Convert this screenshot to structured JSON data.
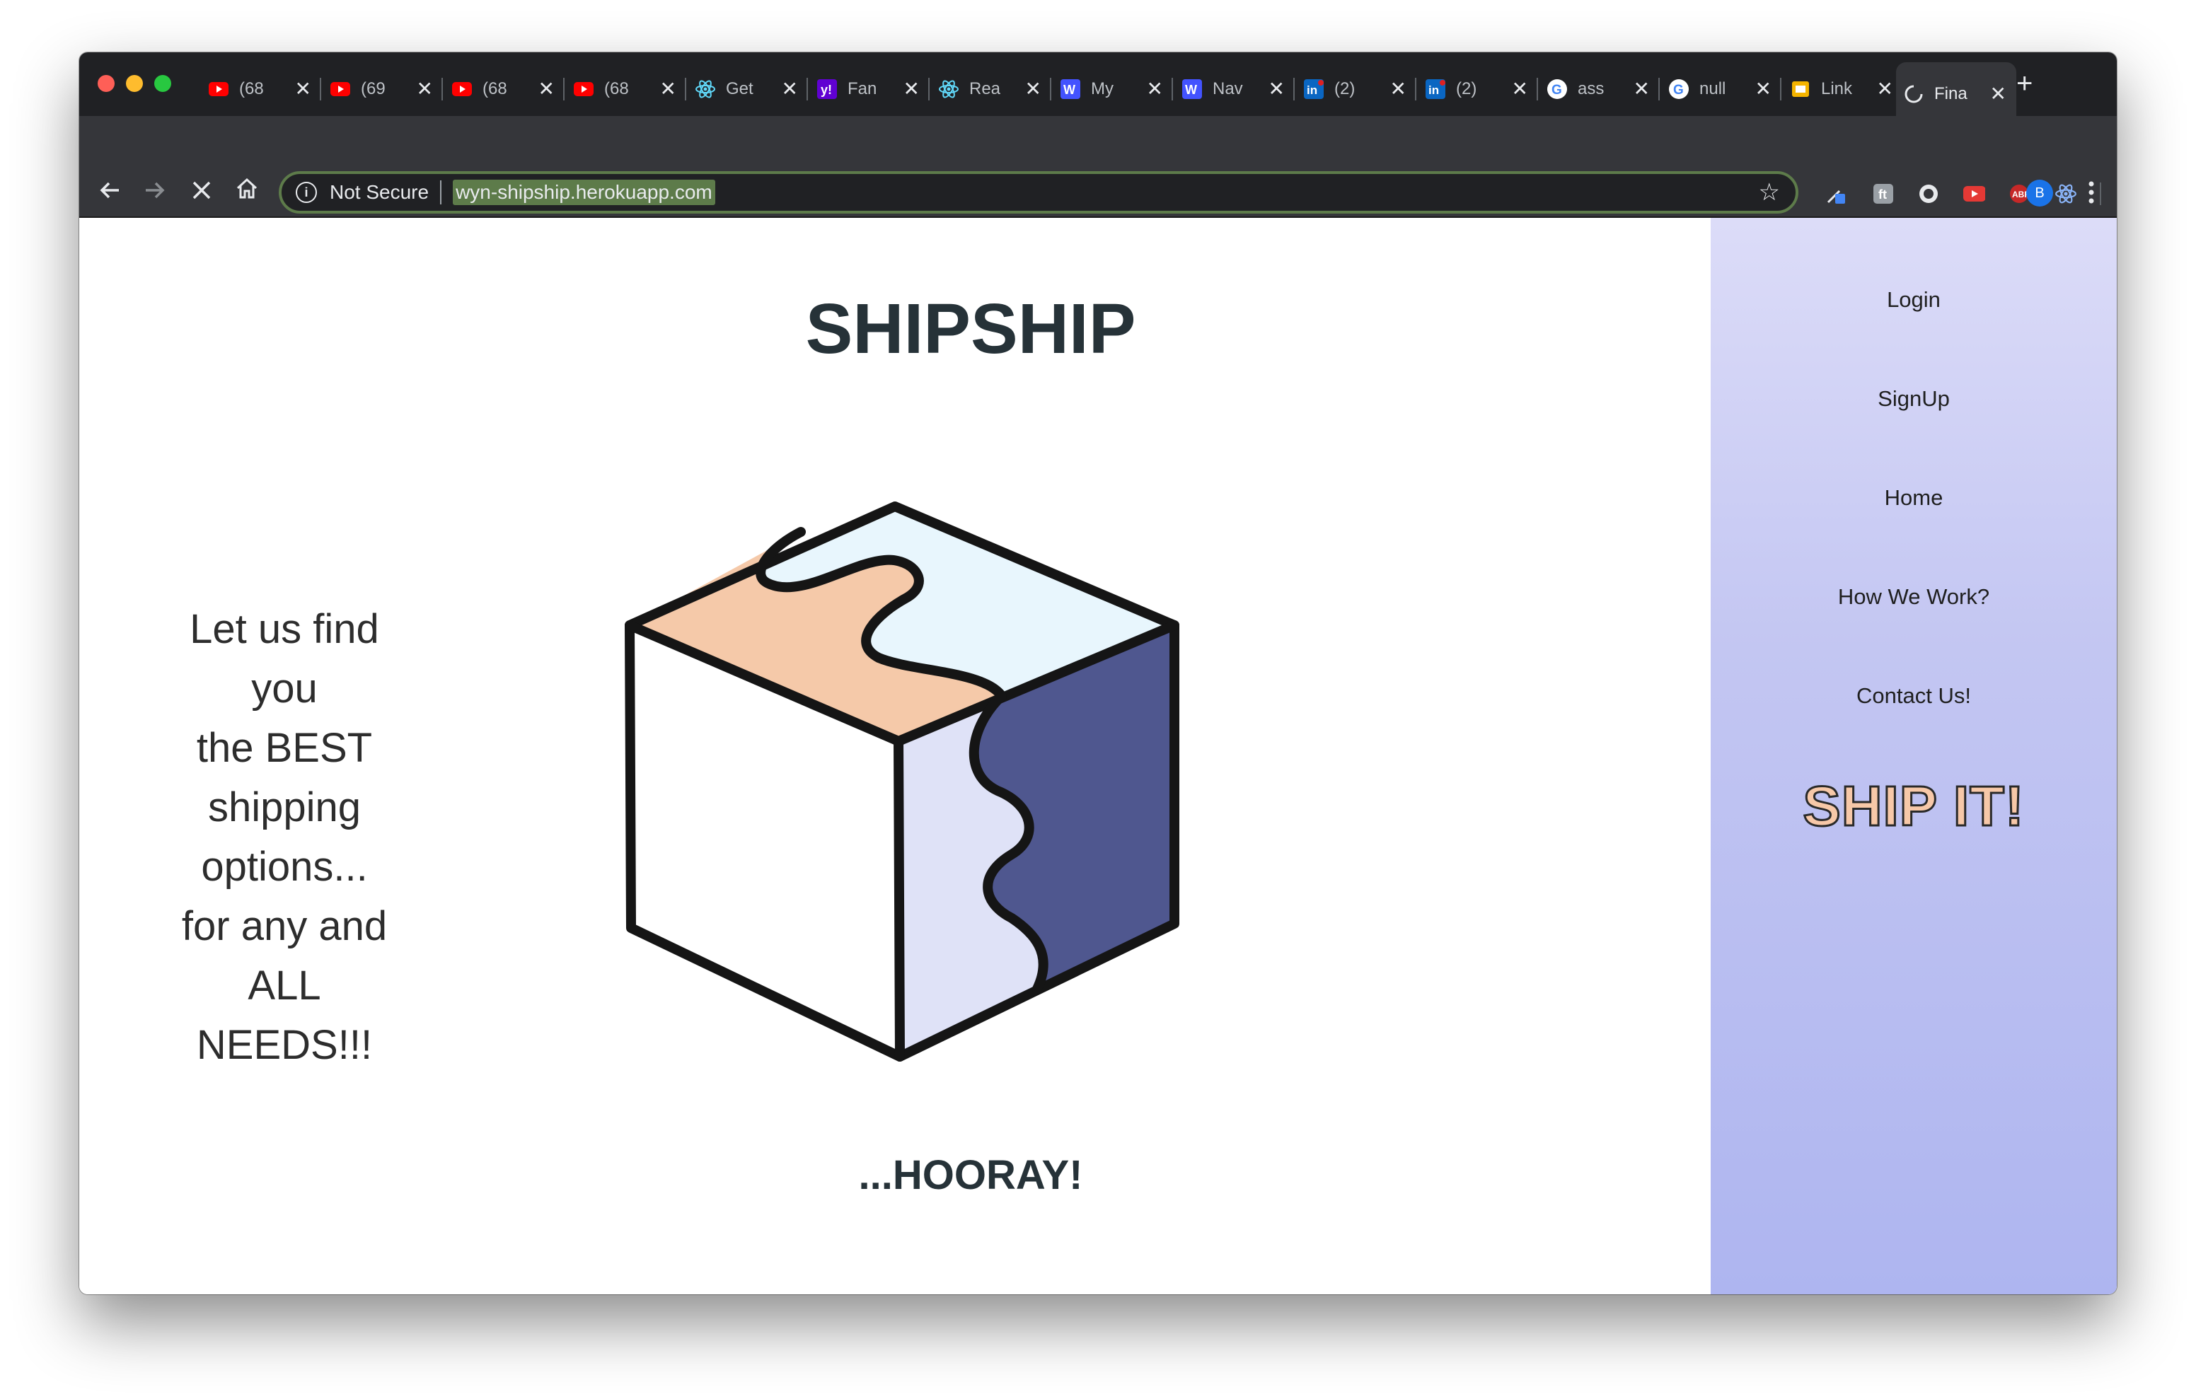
{
  "browser": {
    "tabs": [
      {
        "title": "(68",
        "icon": "youtube-icon"
      },
      {
        "title": "(69",
        "icon": "youtube-icon"
      },
      {
        "title": "(68",
        "icon": "youtube-icon"
      },
      {
        "title": "(68",
        "icon": "youtube-icon"
      },
      {
        "title": "Get",
        "icon": "react-icon"
      },
      {
        "title": "Fan",
        "icon": "yahoo-icon"
      },
      {
        "title": "Rea",
        "icon": "react-icon"
      },
      {
        "title": "My",
        "icon": "webflow-icon"
      },
      {
        "title": "Nav",
        "icon": "webflow-icon"
      },
      {
        "title": "(2)",
        "icon": "linkedin-icon"
      },
      {
        "title": "(2)",
        "icon": "linkedin-icon"
      },
      {
        "title": "ass",
        "icon": "google-icon"
      },
      {
        "title": "null",
        "icon": "google-icon"
      },
      {
        "title": "Link",
        "icon": "slides-icon"
      },
      {
        "title": "Fina",
        "icon": "loading-icon",
        "active": true
      }
    ],
    "tab_close_glyph": "✕",
    "new_tab_glyph": "+",
    "address": {
      "security_label": "Not Secure",
      "url": "wyn-shipship.herokuapp.com"
    },
    "profile_initial": "B"
  },
  "page": {
    "title": "SHIPSHIP",
    "tagline": [
      "Let us find you",
      "the BEST",
      "shipping",
      "options...",
      "for any and",
      "ALL NEEDS!!!"
    ],
    "footer_text": "...HOORAY!",
    "illustration": "box-icon"
  },
  "sidebar": {
    "links": [
      "Login",
      "SignUp",
      "Home",
      "How We Work?",
      "Contact Us!"
    ],
    "cta": "SHIP IT!"
  },
  "colors": {
    "title": "#263238",
    "sidebar_top": "#dcdcf8",
    "sidebar_bottom": "#aeb5f0",
    "cta_fill": "#f7c8a8",
    "box_peach": "#f5c9a9",
    "box_lightblue": "#e8f6fd",
    "box_lavender": "#dfe2f7",
    "box_navy": "#4f578f"
  }
}
